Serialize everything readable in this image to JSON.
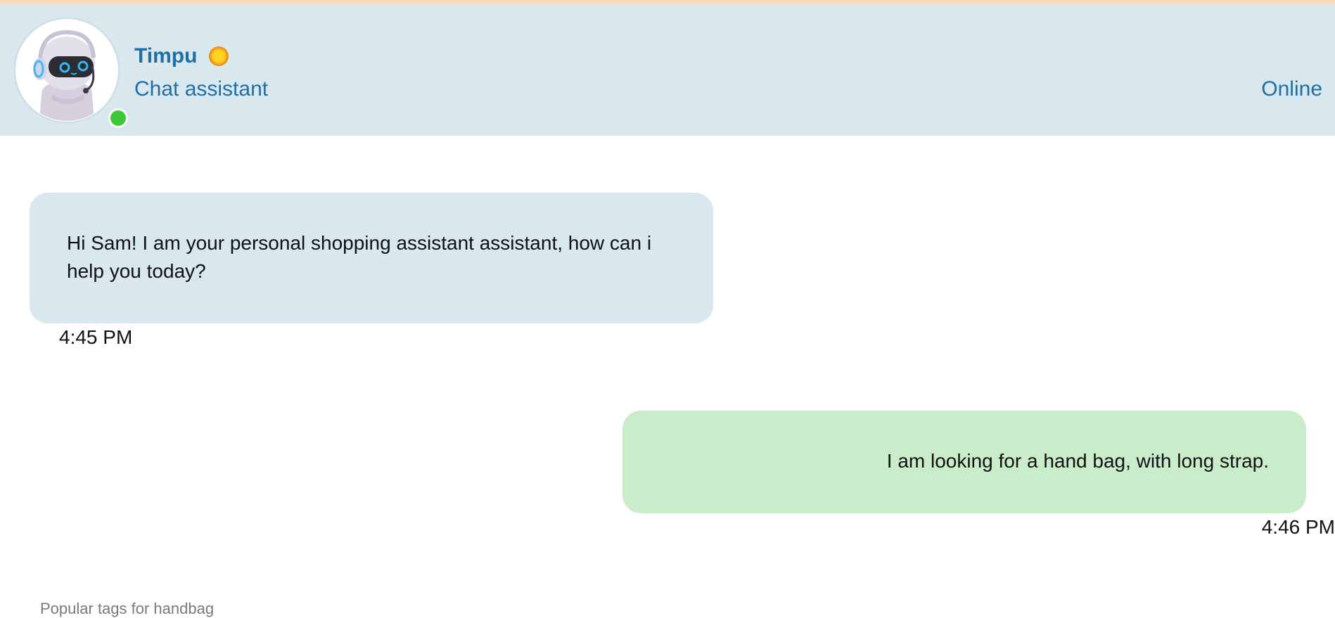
{
  "header": {
    "name": "Timpu",
    "subtitle": "Chat assistant",
    "status": "Online",
    "avatar_icon": "robot-avatar-icon",
    "badge_icon": "sun-icon"
  },
  "colors": {
    "header_bg": "#d9e7ef",
    "accent": "#1f6fa5",
    "bot_bubble": "#d9e7ef",
    "user_bubble": "#c9edca",
    "online": "#3ec83b",
    "top_strip": "#fadcbc"
  },
  "messages": [
    {
      "sender": "bot",
      "text": "Hi Sam! I am your personal shopping assistant assistant, how can i help you today?",
      "time": "4:45 PM"
    },
    {
      "sender": "user",
      "text": "I am looking for a hand bag, with long strap.",
      "time": "4:46 PM"
    }
  ],
  "tags": {
    "label": "Popular tags for handbag"
  }
}
